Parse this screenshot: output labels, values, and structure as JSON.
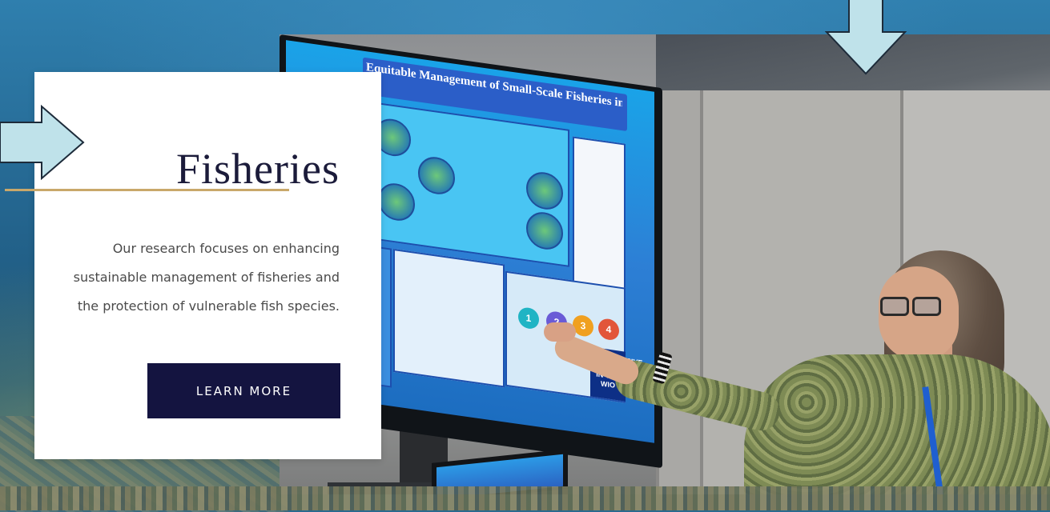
{
  "section": {
    "title": "Fisheries",
    "description": "Our research focuses on enhancing sustainable management of fisheries and the protection of vulnerable fish species.",
    "button_label": "LEARN MORE"
  },
  "photo": {
    "poster_title": "Equitable Management of Small-Scale Fisheries in the WIO",
    "poster_badge": "PROGRESSIVE FISHING IN THE WIO",
    "steps": [
      "1",
      "2",
      "3",
      "4"
    ]
  },
  "colors": {
    "button_bg": "#141440",
    "accent_rule": "#c9a86a",
    "arrow_fill": "#bfe2ea",
    "title_color": "#1b1b3a"
  },
  "icons": {
    "right_arrow": "arrow-right-icon",
    "down_arrow": "arrow-down-icon"
  }
}
